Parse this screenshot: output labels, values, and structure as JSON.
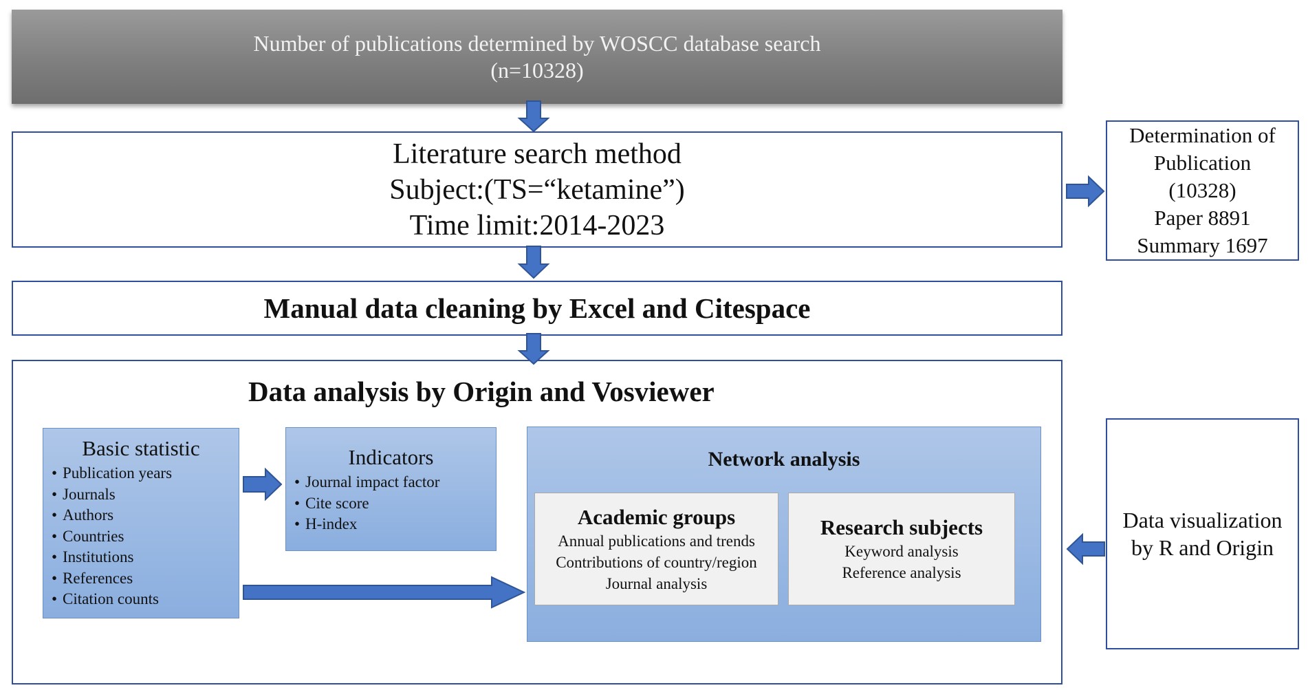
{
  "top_box": {
    "line1": "Number of publications determined by WOSCC database search",
    "line2": "(n=10328)"
  },
  "search_method": {
    "title": "Literature search method",
    "subject": "Subject:(TS=“ketamine”)",
    "time_limit": "Time limit:2014-2023"
  },
  "determination": {
    "line1": "Determination of",
    "line2": "Publication",
    "line3": "(10328)",
    "paper": "Paper 8891",
    "summary": "Summary 1697"
  },
  "cleaning": {
    "label": "Manual data cleaning by Excel and Citespace"
  },
  "analysis": {
    "title": "Data analysis by Origin and Vosviewer",
    "basic_statistic": {
      "title": "Basic statistic",
      "items": [
        "Publication years",
        "Journals",
        "Authors",
        "Countries",
        "Institutions",
        "References",
        "Citation counts"
      ]
    },
    "indicators": {
      "title": "Indicators",
      "items": [
        "Journal impact factor",
        "Cite score",
        "H-index"
      ]
    },
    "network": {
      "title": "Network analysis",
      "academic_groups": {
        "title": "Academic groups",
        "lines": [
          "Annual publications and trends",
          "Contributions of country/region",
          "Journal analysis"
        ]
      },
      "research_subjects": {
        "title": "Research subjects",
        "lines": [
          "Keyword analysis",
          "Reference analysis"
        ]
      }
    }
  },
  "visualization": {
    "line1": "Data visualization",
    "line2": "by R and Origin"
  },
  "colors": {
    "arrow_fill": "#4472c4",
    "arrow_stroke": "#2f5597",
    "outline": "#2f4f9e",
    "blue_box_top": "#aec6e8",
    "blue_box_bottom": "#8aaedf",
    "grey_header": "#8a8a8a"
  }
}
